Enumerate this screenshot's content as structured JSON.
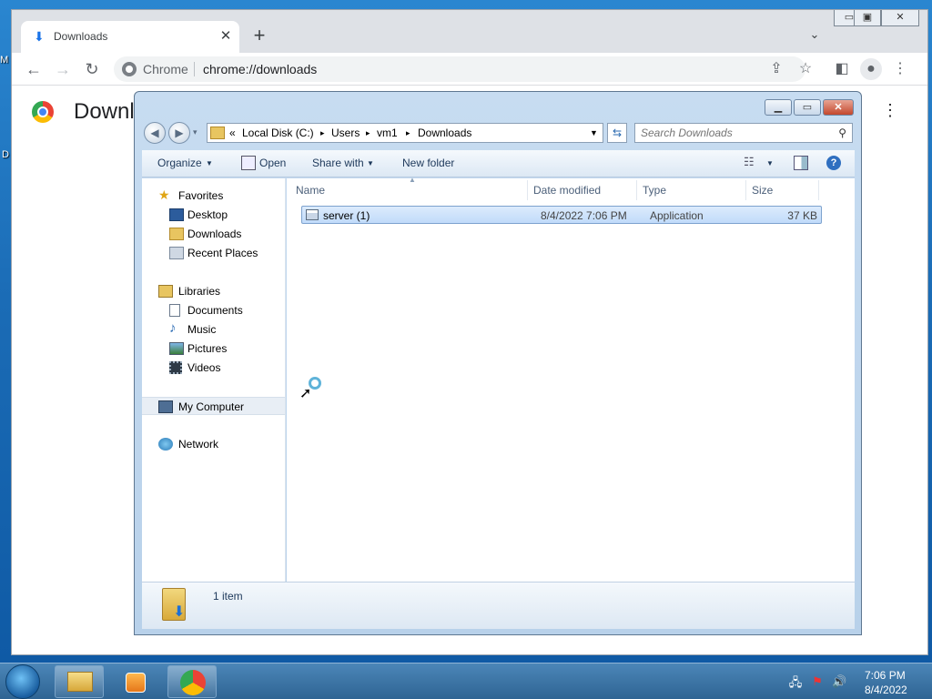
{
  "desktop": {
    "edge_letter_top": "M",
    "edge_letter_mid": "D"
  },
  "chrome": {
    "tab_title": "Downloads",
    "tab_close": "✕",
    "new_tab": "+",
    "omnibox_label": "Chrome",
    "url": "chrome://downloads",
    "page_title": "Downloads",
    "page_menu": "⋮"
  },
  "explorer": {
    "address": {
      "overflow": "«",
      "crumbs": [
        "Local Disk (C:)",
        "Users",
        "vm1",
        "Downloads"
      ],
      "separator": "▸"
    },
    "search_placeholder": "Search Downloads",
    "commands": {
      "organize": "Organize",
      "open": "Open",
      "share_with": "Share with",
      "new_folder": "New folder"
    },
    "nav": {
      "favorites": "Favorites",
      "desktop": "Desktop",
      "downloads": "Downloads",
      "recent_places": "Recent Places",
      "libraries": "Libraries",
      "documents": "Documents",
      "music": "Music",
      "pictures": "Pictures",
      "videos": "Videos",
      "my_computer": "My Computer",
      "network": "Network"
    },
    "columns": {
      "name": "Name",
      "date_modified": "Date modified",
      "type": "Type",
      "size": "Size"
    },
    "files": [
      {
        "name": "server (1)",
        "date_modified": "8/4/2022 7:06 PM",
        "type": "Application",
        "size": "37 KB"
      }
    ],
    "details": {
      "count": "1 item"
    }
  },
  "taskbar": {
    "time": "7:06 PM",
    "date": "8/4/2022"
  },
  "colors": {
    "chrome_tabstrip": "#dee1e6",
    "explorer_frame": "#c7dcf1",
    "selection": "#c1dbfa",
    "taskbar": "#3a73a6"
  }
}
